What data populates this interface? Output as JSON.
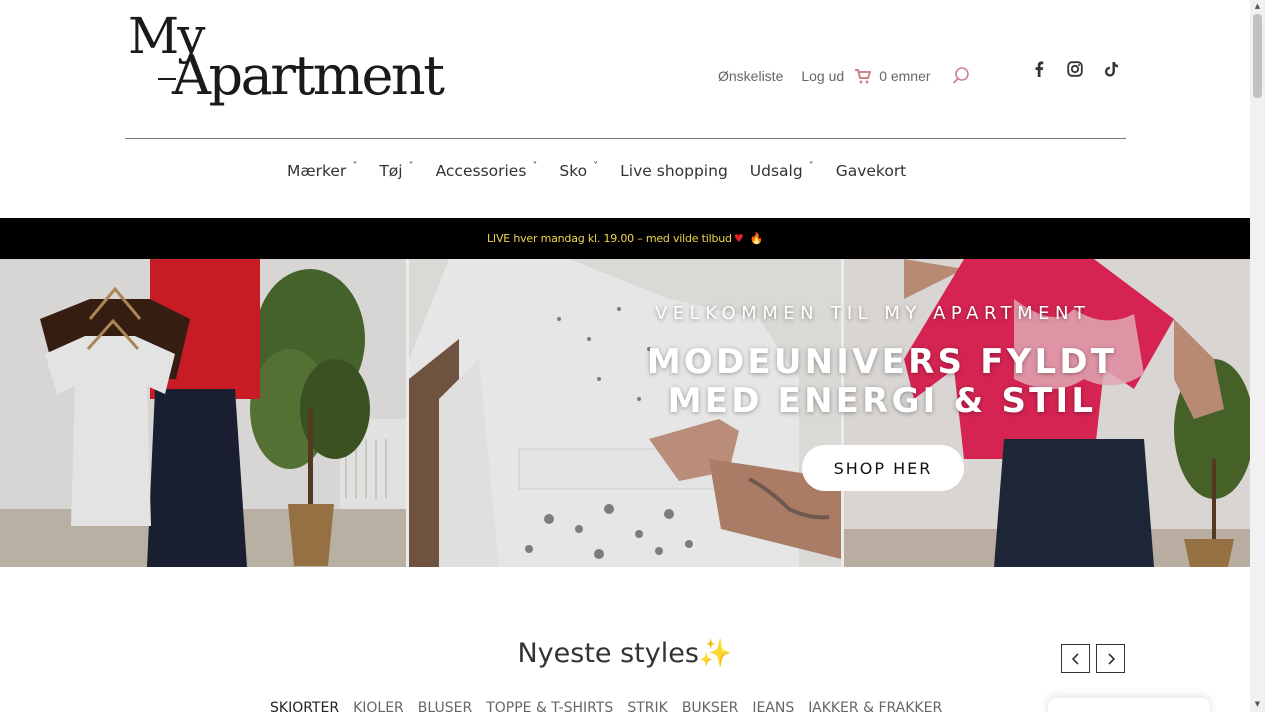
{
  "logo": {
    "line1": "My",
    "line2": "Apartment"
  },
  "topnav": {
    "wishlist": "Ønskeliste",
    "logout": "Log ud",
    "cart": "0 emner"
  },
  "social": [
    "facebook-icon",
    "instagram-icon",
    "tiktok-icon"
  ],
  "mainnav": {
    "items": [
      {
        "label": "Mærker",
        "dropdown": true
      },
      {
        "label": "Tøj",
        "dropdown": true
      },
      {
        "label": "Accessories",
        "dropdown": true
      },
      {
        "label": "Sko",
        "dropdown": true
      },
      {
        "label": "Live shopping",
        "dropdown": false
      },
      {
        "label": "Udsalg",
        "dropdown": true
      },
      {
        "label": "Gavekort",
        "dropdown": false
      }
    ],
    "chevron": "˅"
  },
  "announcement": {
    "text": "LIVE hver mandag kl. 19.00 – med vilde tilbud",
    "heart": "♥",
    "fire": "🔥"
  },
  "hero": {
    "subtitle": "VELKOMMEN TIL MY APARTMENT",
    "title_line1": "MODEUNIVERS FYLDT",
    "title_line2": "MED ENERGI & STIL",
    "button": "SHOP HER"
  },
  "newest": {
    "title": "Nyeste styles",
    "sparkle": "✨",
    "prev": "‹",
    "next": "›",
    "categories": [
      "SKJORTER",
      "KJOLER",
      "BLUSER",
      "TOPPE & T-SHIRTS",
      "STRIK",
      "BUKSER",
      "JEANS",
      "JAKKER & FRAKKER"
    ]
  },
  "colors": {
    "accent": "#c9858e",
    "announce_bg": "#000000",
    "announce_text": "#f1d64c"
  }
}
